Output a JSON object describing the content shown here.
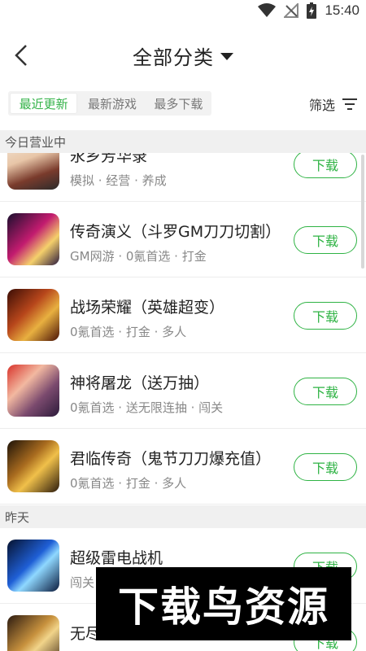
{
  "status_bar": {
    "time": "15:40",
    "icons": [
      "wifi-icon",
      "signal-off-icon",
      "battery-charging-icon"
    ]
  },
  "header": {
    "title": "全部分类",
    "back_icon": "chevron-left-icon",
    "dropdown_icon": "caret-down-icon"
  },
  "tabs": [
    {
      "label": "最近更新",
      "active": true
    },
    {
      "label": "最新游戏",
      "active": false
    },
    {
      "label": "最多下载",
      "active": false
    }
  ],
  "filter": {
    "label": "筛选",
    "icon": "filter-lines-icon"
  },
  "sections": [
    {
      "title": "今日营业中",
      "items": [
        {
          "name": "永乡芳华录",
          "tags": "模拟 · 经营 · 养成",
          "button": "下载"
        },
        {
          "name": "传奇演义（斗罗GM刀刀切割）",
          "tags": "GM网游 · 0氪首选 · 打金",
          "button": "下载"
        },
        {
          "name": "战场荣耀（英雄超变）",
          "tags": "0氪首选 · 打金 · 多人",
          "button": "下载"
        },
        {
          "name": "神将屠龙（送万抽）",
          "tags": "0氪首选 · 送无限连抽 · 闯关",
          "button": "下载"
        },
        {
          "name": "君临传奇（鬼节刀刀爆充值）",
          "tags": "0氪首选 · 打金 · 多人",
          "button": "下载"
        }
      ]
    },
    {
      "title": "昨天",
      "items": [
        {
          "name": "超级雷电战机",
          "tags": "闯关",
          "button": "下载"
        },
        {
          "name": "无尽",
          "tags": "",
          "button": "下载"
        }
      ]
    }
  ],
  "watermark": {
    "text": "下载鸟资源"
  },
  "colors": {
    "accent": "#2fb344",
    "section_bg": "#f0f0f0",
    "tab_bg": "#f2f2f2"
  }
}
